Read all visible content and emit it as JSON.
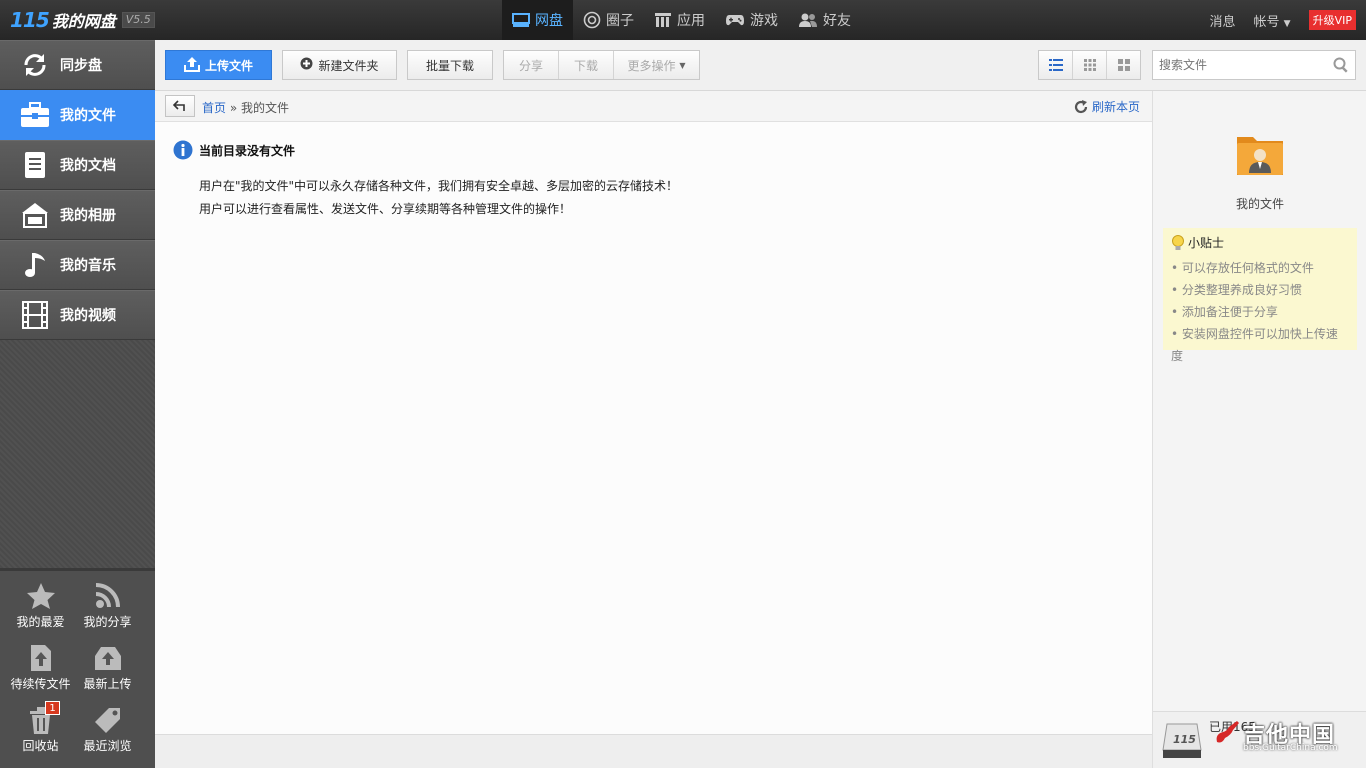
{
  "app": {
    "logo_number": "115",
    "logo_name": "我的网盘",
    "version": "V5.5"
  },
  "topnav": {
    "items": [
      {
        "label": "网盘",
        "icon": "drive-icon"
      },
      {
        "label": "圈子",
        "icon": "circle-icon"
      },
      {
        "label": "应用",
        "icon": "apps-icon"
      },
      {
        "label": "游戏",
        "icon": "gamepad-icon"
      },
      {
        "label": "好友",
        "icon": "friends-icon"
      }
    ],
    "messages": "消息",
    "account": "帐号",
    "vip": "升级VIP"
  },
  "sidebar": {
    "items": [
      {
        "label": "同步盘",
        "icon": "sync-icon"
      },
      {
        "label": "我的文件",
        "icon": "briefcase-icon"
      },
      {
        "label": "我的文档",
        "icon": "document-icon"
      },
      {
        "label": "我的相册",
        "icon": "album-icon"
      },
      {
        "label": "我的音乐",
        "icon": "music-icon"
      },
      {
        "label": "我的视频",
        "icon": "film-icon"
      }
    ],
    "bottom": [
      {
        "label": "我的最爱",
        "icon": "star-icon"
      },
      {
        "label": "我的分享",
        "icon": "rss-icon"
      },
      {
        "label": "待续传文件",
        "icon": "upload-pending-icon"
      },
      {
        "label": "最新上传",
        "icon": "recent-upload-icon"
      },
      {
        "label": "回收站",
        "icon": "trash-icon",
        "badge": "1"
      },
      {
        "label": "最近浏览",
        "icon": "tag-icon"
      }
    ]
  },
  "toolbar": {
    "upload": "上传文件",
    "new_folder": "新建文件夹",
    "batch_download": "批量下载",
    "share": "分享",
    "download": "下载",
    "more": "更多操作",
    "search_placeholder": "搜索文件"
  },
  "breadcrumb": {
    "home": "首页",
    "sep": "»",
    "current": "我的文件",
    "refresh": "刷新本页"
  },
  "main": {
    "empty_title": "当前目录没有文件",
    "line1": "用户在\"我的文件\"中可以永久存储各种文件，我们拥有安全卓越、多层加密的云存储技术！",
    "line2": "用户可以进行查看属性、发送文件、分享续期等各种管理文件的操作！"
  },
  "rightpanel": {
    "folder_name": "我的文件",
    "tips_title": "小贴士",
    "tips": [
      "• 可以存放任何格式的文件",
      "• 分类整理养成良好习惯",
      "• 添加备注便于分享",
      "• 安装网盘控件可以加快上传速度"
    ],
    "usage": "已用165",
    "watermark": "吉他中国",
    "watermark_sub": "bbs.GuitarChina.com"
  },
  "colors": {
    "accent": "#3b8cf2",
    "topbar": "#2e2e2e",
    "vip": "#e82f2f",
    "tips_bg": "#fbf8d0"
  }
}
